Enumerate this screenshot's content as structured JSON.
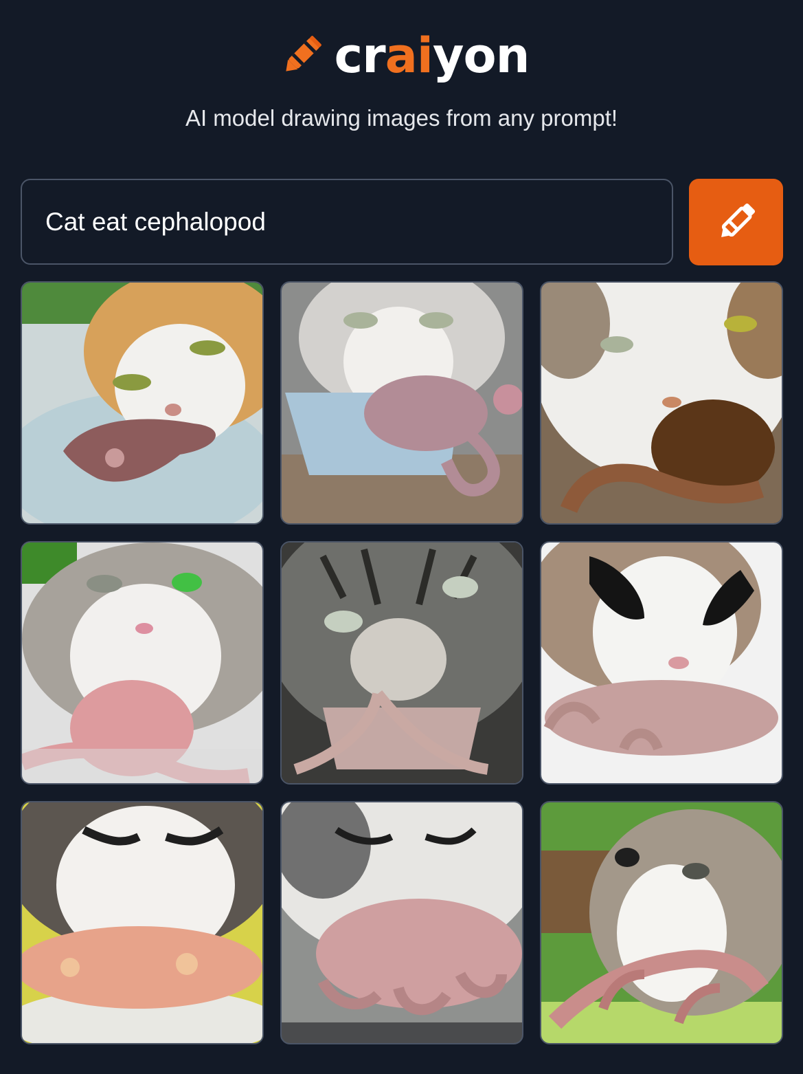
{
  "app": {
    "brand_prefix": "cr",
    "brand_accent": "ai",
    "brand_suffix": "yon",
    "tagline": "AI model drawing images from any prompt!"
  },
  "prompt": {
    "value": "Cat eat cephalopod",
    "submit_icon": "crayon-icon"
  },
  "colors": {
    "background": "#131a27",
    "accent": "#e65d12",
    "brand_orange": "#f0701f",
    "border": "#4b5567"
  },
  "results": [
    {
      "cat": "orange-white",
      "creature": "brown squid",
      "surface": "white plate"
    },
    {
      "cat": "grey-white tabby",
      "creature": "pink octopus",
      "surface": "blue bowl on wood"
    },
    {
      "cat": "brown-white tabby",
      "creature": "brown octopus",
      "surface": "table"
    },
    {
      "cat": "grey-white",
      "creature": "pink octopus",
      "surface": "white table"
    },
    {
      "cat": "grey tabby",
      "creature": "pale octopus",
      "surface": "table"
    },
    {
      "cat": "black-white",
      "creature": "pink octopus",
      "surface": "white table"
    },
    {
      "cat": "white-grey",
      "creature": "orange octopus",
      "surface": "yellow plate"
    },
    {
      "cat": "white-grey",
      "creature": "pink octopus",
      "surface": "dark plate"
    },
    {
      "cat": "grey-white",
      "creature": "pink octopus",
      "surface": "green grass"
    }
  ]
}
